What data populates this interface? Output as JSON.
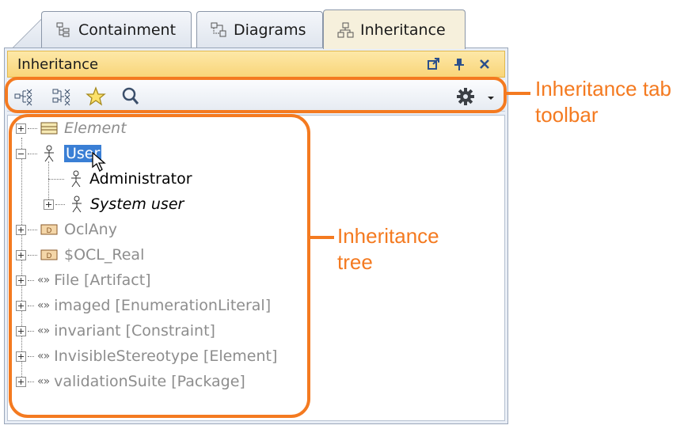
{
  "tabs": [
    {
      "label": "Containment",
      "icon": "containment-tree-icon",
      "active": false
    },
    {
      "label": "Diagrams",
      "icon": "diagrams-icon",
      "active": false
    },
    {
      "label": "Inheritance",
      "icon": "inheritance-icon",
      "active": true
    }
  ],
  "panel": {
    "title": "Inheritance",
    "title_buttons": [
      "undock-icon",
      "pin-icon",
      "close-icon"
    ]
  },
  "toolbar": {
    "tools": [
      "expand-tree-icon",
      "collapse-tree-icon",
      "favorite-star-icon",
      "search-icon"
    ],
    "options": "gear-icon"
  },
  "tree": [
    {
      "label": "Element",
      "icon": "class-icon",
      "style": "gray-italic",
      "expander": "plus"
    },
    {
      "label": "User",
      "icon": "actor-icon",
      "style": "selected",
      "expander": "minus"
    },
    {
      "label": "Administrator",
      "icon": "actor-icon",
      "style": "black",
      "expander": "none"
    },
    {
      "label": "System user",
      "icon": "actor-icon",
      "style": "black-italic",
      "expander": "plus"
    },
    {
      "label": "OclAny",
      "icon": "datatype-icon",
      "style": "gray",
      "expander": "plus"
    },
    {
      "label": "$OCL_Real",
      "icon": "datatype-icon",
      "style": "gray",
      "expander": "plus"
    },
    {
      "label": "File [Artifact]",
      "icon": "stereotype-icon",
      "style": "gray",
      "expander": "plus"
    },
    {
      "label": "imaged [EnumerationLiteral]",
      "icon": "stereotype-icon",
      "style": "gray",
      "expander": "plus"
    },
    {
      "label": "invariant [Constraint]",
      "icon": "stereotype-icon",
      "style": "gray",
      "expander": "plus"
    },
    {
      "label": "InvisibleStereotype [Element]",
      "icon": "stereotype-icon",
      "style": "gray",
      "expander": "plus"
    },
    {
      "label": "validationSuite [Package]",
      "icon": "stereotype-icon",
      "style": "gray",
      "expander": "plus"
    }
  ],
  "annotations": {
    "toolbar_line1": "Inheritance tab",
    "toolbar_line2": "toolbar",
    "tree_line1": "Inheritance",
    "tree_line2": "tree"
  },
  "stereotype_glyph": "«»",
  "colors": {
    "accent": "#f47a20",
    "selection": "#3a7fd5",
    "title_bar": "#f9d579"
  }
}
